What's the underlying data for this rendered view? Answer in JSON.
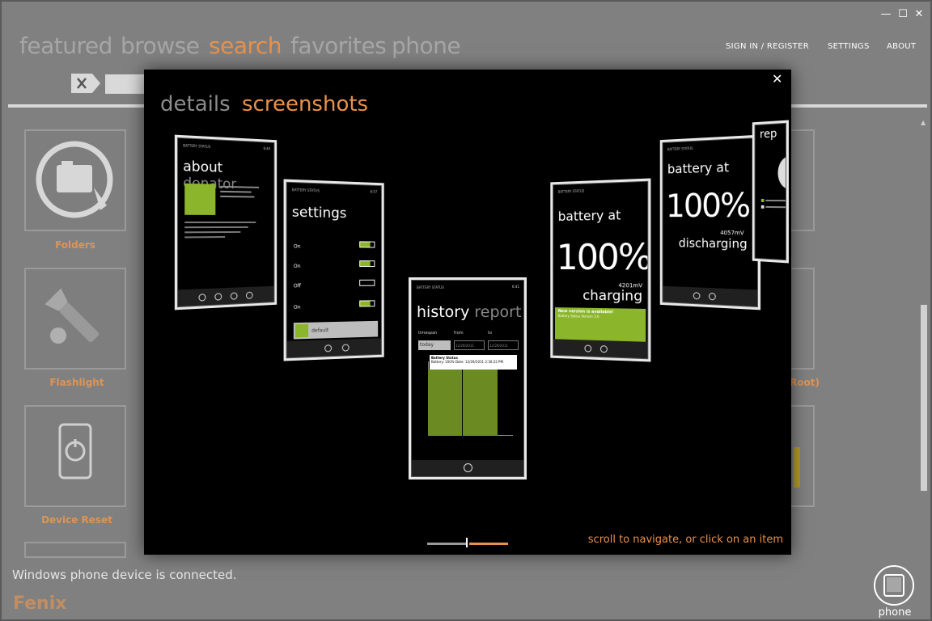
{
  "window": {
    "minimize": "—",
    "maximize": "☐",
    "close": "✕"
  },
  "nav": {
    "items": [
      {
        "label": "featured"
      },
      {
        "label": "browse"
      },
      {
        "label": "search"
      },
      {
        "label": "favorites"
      },
      {
        "label": "phone"
      }
    ],
    "active": "search"
  },
  "top_links": {
    "signin": "SIGN IN / REGISTER",
    "settings": "SETTINGS",
    "about": "ABOUT"
  },
  "search": {
    "clear_icon": "clear-icon",
    "value": ""
  },
  "tiles": [
    {
      "label": "Folders",
      "icon": "folder-icon"
    },
    {
      "label": "Flashlight",
      "icon": "flashlight-icon"
    },
    {
      "label": "Device Reset",
      "icon": "reset-icon"
    }
  ],
  "right_tile_partial": "Root)",
  "status": {
    "message": "Windows phone device is connected."
  },
  "brand": "Fenix",
  "phone_button": {
    "label": "phone",
    "icon": "phone-icon"
  },
  "modal": {
    "close": "✕",
    "tabs": [
      {
        "label": "details"
      },
      {
        "label": "screenshots"
      }
    ],
    "active_tab": "screenshots",
    "hint": "scroll to navigate, or click on an item",
    "screenshots": [
      {
        "app": "BATTERY STATUS",
        "title_main": "about",
        "title_sub": "donator",
        "time": "6:44"
      },
      {
        "app": "BATTERY STATUS",
        "title_main": "settings",
        "time": "6:57",
        "rows": [
          "On",
          "On",
          "Off",
          "On"
        ],
        "selected": "default"
      },
      {
        "app": "BATTERY STATUS",
        "title_main": "history",
        "title_sub": "report",
        "time": "6:41",
        "timespan_label": "timespan",
        "from_label": "from",
        "to_label": "to",
        "timespan": "today",
        "from": "12/29/2011",
        "to": "12/29/2011",
        "tooltip_title": "Battery Status",
        "tooltip_body": "Battery: 100%  Date: 12/29/2011 2:30:22 PM"
      },
      {
        "app": "BATTERY STATUS",
        "title_main": "battery at",
        "percent": "100%",
        "mv": "4201mV",
        "state": "charging",
        "banner_title": "New version is available!",
        "banner_body": "Battery Status Version 3.0"
      },
      {
        "app": "BATTERY STATUS",
        "title_main": "battery at",
        "percent": "100%",
        "mv": "4057mV",
        "state": "discharging"
      },
      {
        "title_main": "rep"
      }
    ]
  }
}
